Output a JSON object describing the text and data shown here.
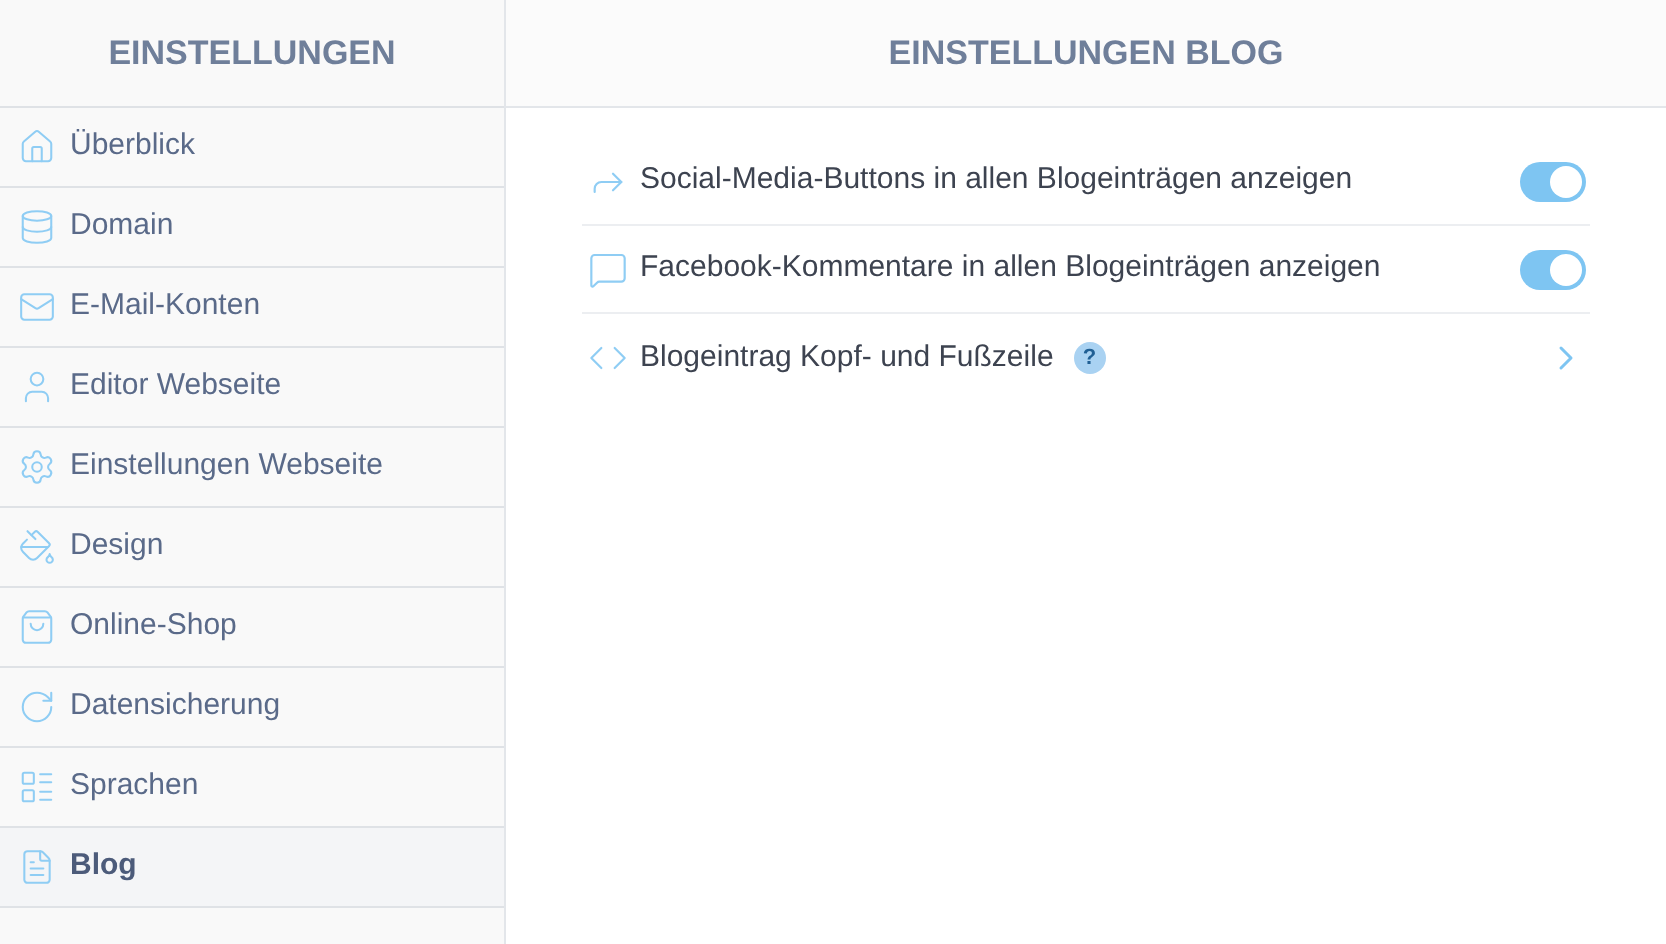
{
  "sidebar": {
    "title": "EINSTELLUNGEN",
    "items": [
      {
        "label": "Überblick",
        "selected": false
      },
      {
        "label": "Domain",
        "selected": false
      },
      {
        "label": "E-Mail-Konten",
        "selected": false
      },
      {
        "label": "Editor Webseite",
        "selected": false
      },
      {
        "label": "Einstellungen Webseite",
        "selected": false
      },
      {
        "label": "Design",
        "selected": false
      },
      {
        "label": "Online-Shop",
        "selected": false
      },
      {
        "label": "Datensicherung",
        "selected": false
      },
      {
        "label": "Sprachen",
        "selected": false
      },
      {
        "label": "Blog",
        "selected": true
      }
    ]
  },
  "main": {
    "title": "EINSTELLUNGEN BLOG",
    "settings": [
      {
        "kind": "toggle",
        "label": "Social-Media-Buttons in allen Blogeinträgen anzeigen",
        "on": true
      },
      {
        "kind": "toggle",
        "label": "Facebook-Kommentare in allen Blogeinträgen anzeigen",
        "on": true
      },
      {
        "kind": "link",
        "label": "Blogeintrag Kopf- und Fußzeile",
        "help": "?"
      }
    ]
  }
}
